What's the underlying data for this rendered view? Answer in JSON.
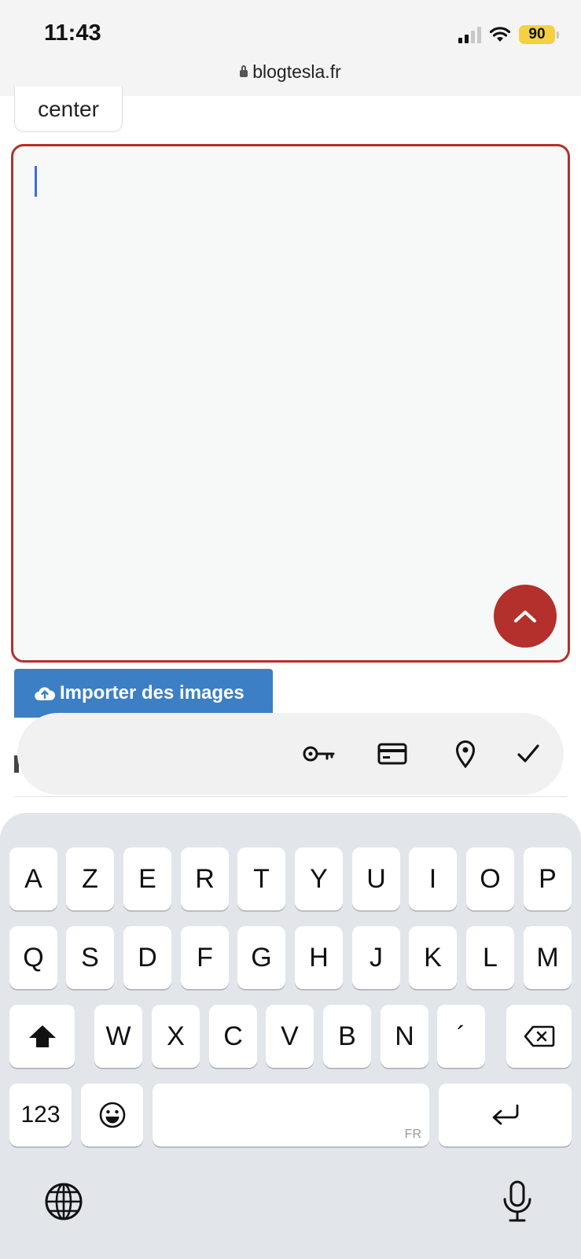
{
  "status_bar": {
    "time": "11:43",
    "battery": "90"
  },
  "browser": {
    "domain": "blogtesla.fr"
  },
  "page": {
    "center_label": "center",
    "import_button_label": "Importer des images"
  },
  "keyboard": {
    "row1": [
      "A",
      "Z",
      "E",
      "R",
      "T",
      "Y",
      "U",
      "I",
      "O",
      "P"
    ],
    "row2": [
      "Q",
      "S",
      "D",
      "F",
      "G",
      "H",
      "J",
      "K",
      "L",
      "M"
    ],
    "row3": [
      "W",
      "X",
      "C",
      "V",
      "B",
      "N",
      "´"
    ],
    "numbers_key": "123",
    "language_tag": "FR"
  },
  "colors": {
    "accent_red": "#b3302c",
    "button_blue": "#3d7fc4",
    "battery_yellow": "#f5d142"
  }
}
